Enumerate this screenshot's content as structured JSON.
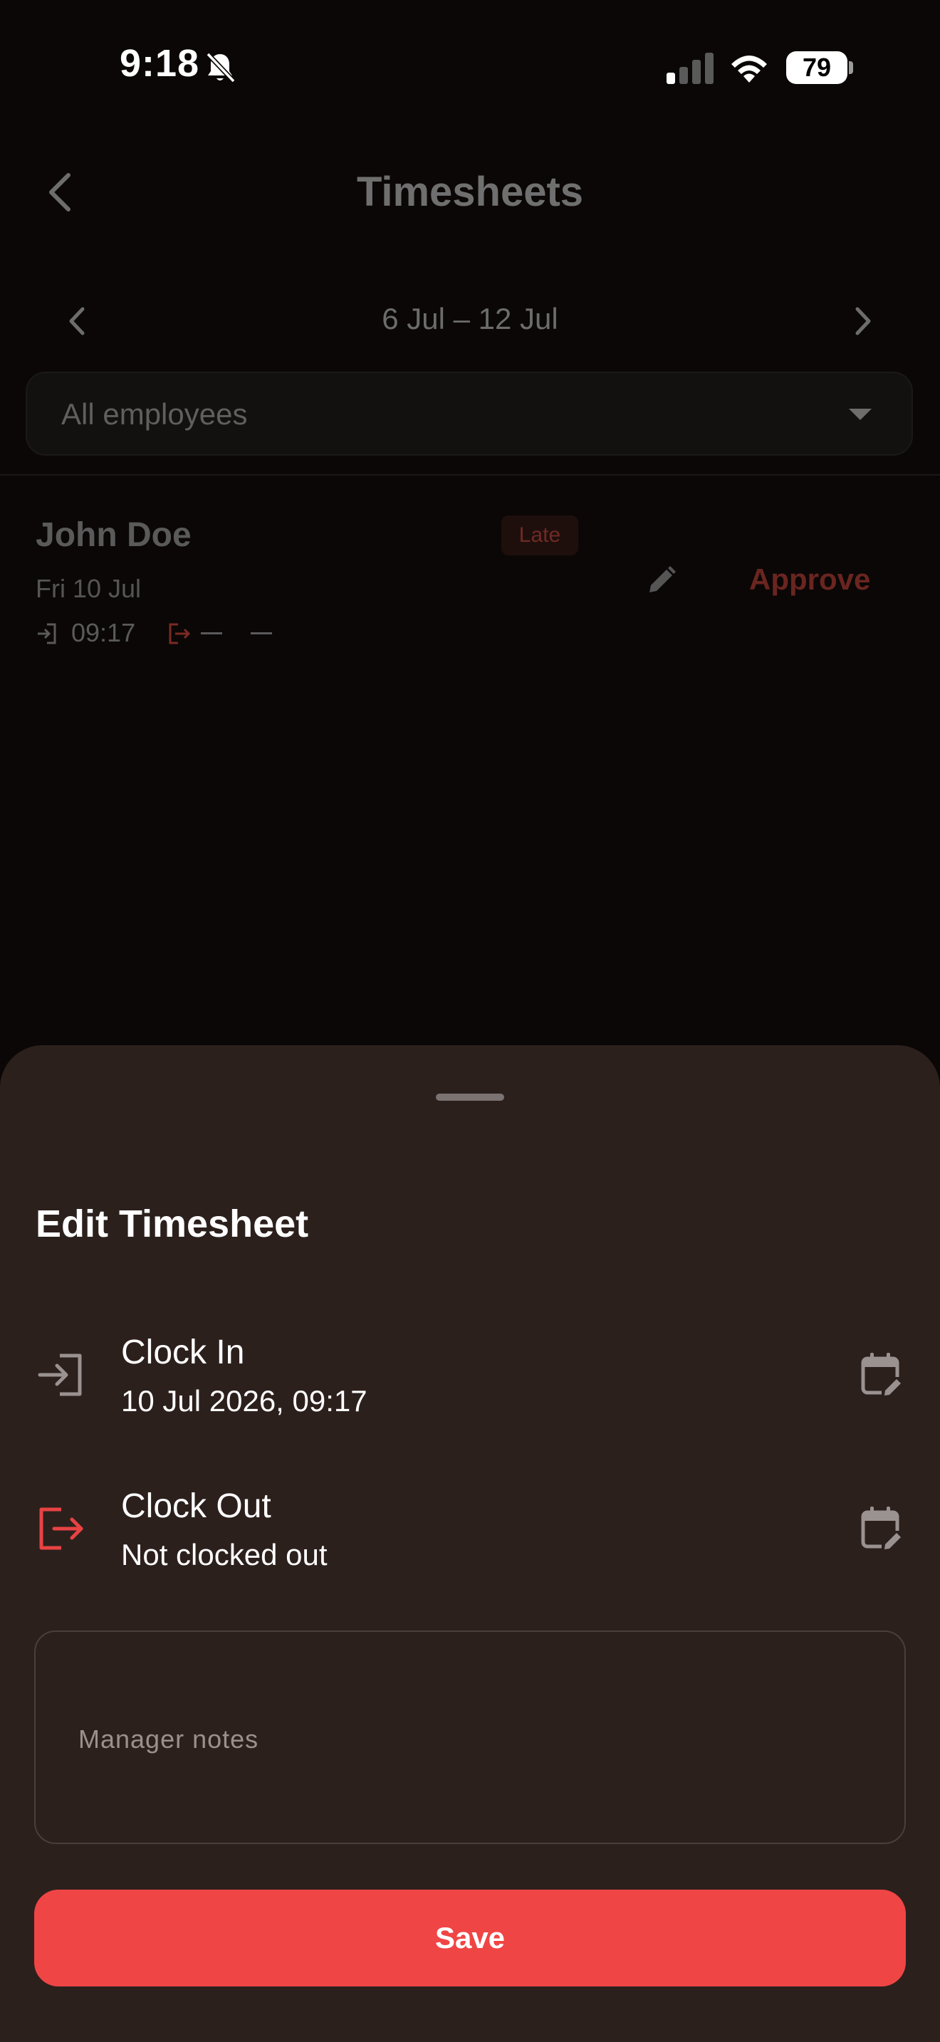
{
  "status_bar": {
    "time": "9:18",
    "battery": "79",
    "icons": [
      "bell-slash-icon",
      "cellular-signal-icon",
      "wifi-icon",
      "battery-icon"
    ]
  },
  "header": {
    "title": "Timesheets",
    "back_icon": "chevron-left-icon"
  },
  "week": {
    "label": "6 Jul – 12 Jul",
    "prev_icon": "chevron-left-icon",
    "next_icon": "chevron-right-icon"
  },
  "filter": {
    "selected": "All employees",
    "caret_icon": "caret-down-icon"
  },
  "entry": {
    "name": "John Doe",
    "badge": "Late",
    "date": "Fri 10 Jul",
    "clock_in": "09:17",
    "approve_label": "Approve",
    "edit_icon": "pencil-icon"
  },
  "sheet": {
    "title": "Edit Timesheet",
    "clock_in": {
      "label": "Clock In",
      "value": "10 Jul 2026, 09:17",
      "icon": "login-icon"
    },
    "clock_out": {
      "label": "Clock Out",
      "value": "Not clocked out",
      "icon": "logout-icon"
    },
    "notes_placeholder": "Manager notes",
    "save_label": "Save"
  },
  "colors": {
    "background": "#0b0706",
    "sheet": "#2c201d",
    "accent": "#f04545",
    "clock_out_icon": "#e84343"
  }
}
